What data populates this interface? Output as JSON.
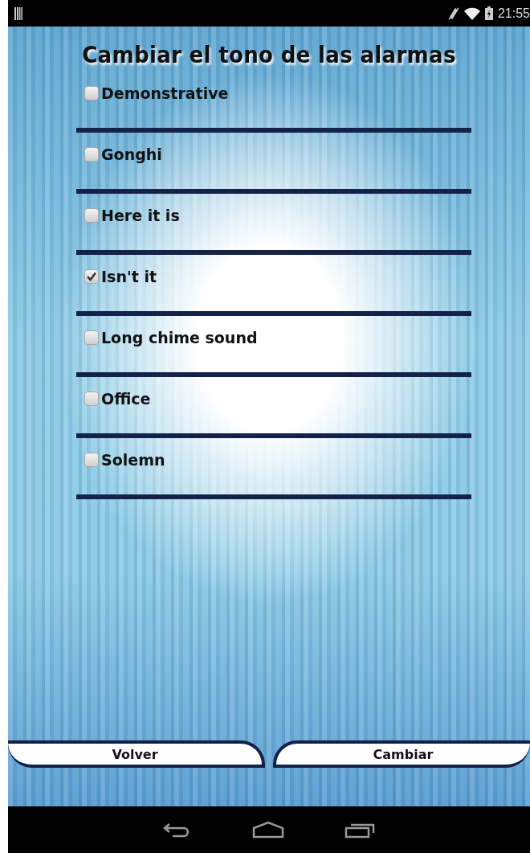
{
  "status_bar": {
    "time": "21:55"
  },
  "title": "Cambiar el tono de las alarmas",
  "tones": [
    {
      "label": "Demonstrative",
      "checked": false
    },
    {
      "label": "Gonghi",
      "checked": false
    },
    {
      "label": "Here it is",
      "checked": false
    },
    {
      "label": "Isn't it",
      "checked": true
    },
    {
      "label": "Long chime sound",
      "checked": false
    },
    {
      "label": "Office",
      "checked": false
    },
    {
      "label": "Solemn",
      "checked": false
    }
  ],
  "buttons": [
    {
      "label": "Volver",
      "kind": "left"
    },
    {
      "label": "Cambiar",
      "kind": "right"
    }
  ]
}
